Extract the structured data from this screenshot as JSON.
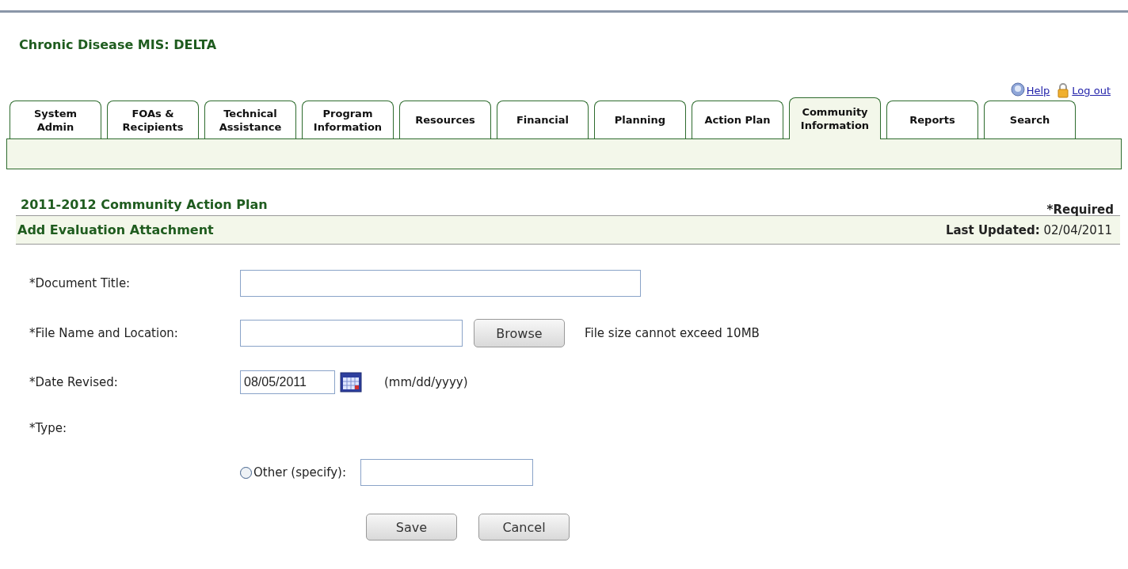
{
  "app_title": "Chronic Disease MIS: DELTA",
  "top_links": [
    {
      "kind": "help",
      "label": "Help"
    },
    {
      "kind": "logout",
      "label": "Log out"
    }
  ],
  "tabs": [
    {
      "label": "System\nAdmin",
      "selected": false
    },
    {
      "label": "FOAs &\nRecipients",
      "selected": false
    },
    {
      "label": "Technical\nAssistance",
      "selected": false
    },
    {
      "label": "Program\nInformation",
      "selected": false
    },
    {
      "label": "Resources",
      "selected": false
    },
    {
      "label": "Financial",
      "selected": false
    },
    {
      "label": "Planning",
      "selected": false
    },
    {
      "label": "Action Plan",
      "selected": false
    },
    {
      "label": "Community\nInformation",
      "selected": true
    },
    {
      "label": "Reports",
      "selected": false
    },
    {
      "label": "Search",
      "selected": false
    }
  ],
  "page_title": "2011-2012 Community Action Plan",
  "required_note": "*Required",
  "section": {
    "title": "Add Evaluation Attachment",
    "updated_label": "Last Updated:",
    "updated_value": "02/04/2011"
  },
  "form": {
    "document_title": {
      "label": "*Document Title:"
    },
    "file": {
      "label": "*File Name and Location:",
      "button": "Browse",
      "hint": "File size cannot exceed 10MB"
    },
    "date": {
      "label": "*Date Revised:",
      "value": "08/05/2011",
      "format": "(mm/dd/yyyy)"
    },
    "type": {
      "label": "*Type:",
      "option": {
        "label": "Other (specify):",
        "selected": false
      }
    }
  },
  "buttons": [
    "Save",
    "Cancel"
  ]
}
